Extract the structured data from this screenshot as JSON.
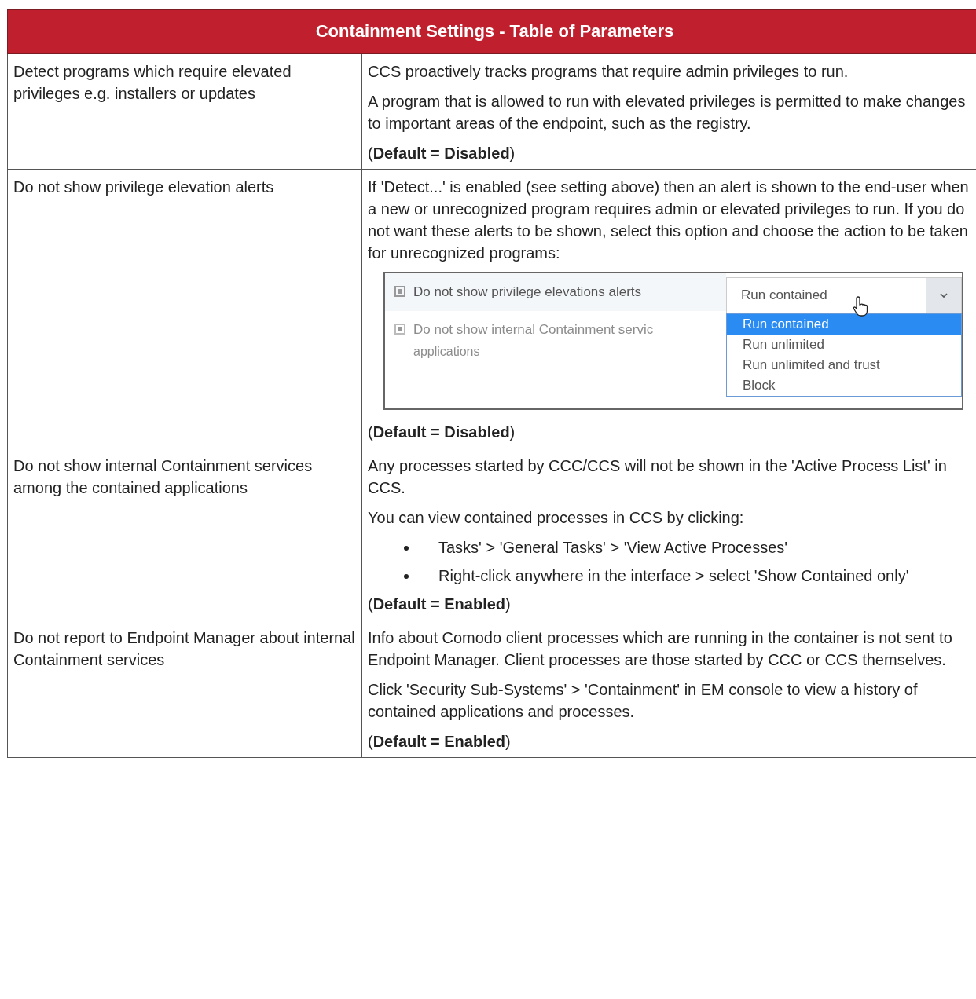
{
  "table": {
    "title": "Containment Settings - Table of Parameters",
    "rows": [
      {
        "setting": "Detect programs which require elevated privileges e.g. installers or updates",
        "blocks": [
          {
            "kind": "paragraph",
            "text": "CCS proactively tracks programs that require admin privileges to run."
          },
          {
            "kind": "paragraph",
            "text": "A program that is allowed to run with elevated privileges is permitted to make changes to important areas of the endpoint, such as the registry."
          },
          {
            "kind": "default",
            "text": "(**Default = Disabled**)"
          }
        ]
      },
      {
        "setting": "Do not show privilege elevation alerts",
        "blocks": [
          {
            "kind": "paragraph",
            "text": "If 'Detect...' is enabled (see setting above) then an alert is shown to the end-user when a new or unrecognized program requires admin or elevated privileges to run. If you do not want these alerts to be shown, select this option and choose the action to be taken for unrecognized programs:"
          },
          {
            "kind": "screenshot",
            "options": [
              {
                "label": "Do not show privilege elevations alerts",
                "checked": true,
                "disabled": false
              },
              {
                "label": "Do not show internal Containment servic",
                "sublabel": "applications",
                "checked": true,
                "disabled": true
              }
            ],
            "dropdown": {
              "value": "Run contained",
              "expanded": true,
              "items": [
                {
                  "label": "Run contained",
                  "selected": true
                },
                {
                  "label": "Run unlimited",
                  "selected": false
                },
                {
                  "label": "Run unlimited and trust",
                  "selected": false
                },
                {
                  "label": "Block",
                  "selected": false
                }
              ]
            }
          },
          {
            "kind": "default",
            "text": "(**Default = Disabled**)"
          }
        ]
      },
      {
        "setting": "Do not show internal Containment services among the contained applications",
        "blocks": [
          {
            "kind": "paragraph",
            "text": "Any processes started by CCC/CCS will not be shown in the 'Active Process List' in CCS."
          },
          {
            "kind": "paragraph",
            "text": "You can view contained processes in CCS by clicking:"
          },
          {
            "kind": "bullets",
            "items": [
              "Tasks' > 'General Tasks' > 'View Active Processes'",
              "Right-click anywhere in the interface > select 'Show Contained only'"
            ]
          },
          {
            "kind": "default",
            "text": "(**Default = Enabled**)"
          }
        ]
      },
      {
        "setting": "Do not report to Endpoint Manager about internal Containment services",
        "blocks": [
          {
            "kind": "paragraph",
            "text": "Info about Comodo client processes which are running in the container is not sent to Endpoint Manager. Client processes are those started by CCC or CCS themselves."
          },
          {
            "kind": "paragraph",
            "text": "Click 'Security Sub-Systems' > 'Containment' in EM console to view a history of contained applications and processes."
          },
          {
            "kind": "default",
            "text": "(**Default = Enabled**)"
          }
        ]
      }
    ]
  }
}
